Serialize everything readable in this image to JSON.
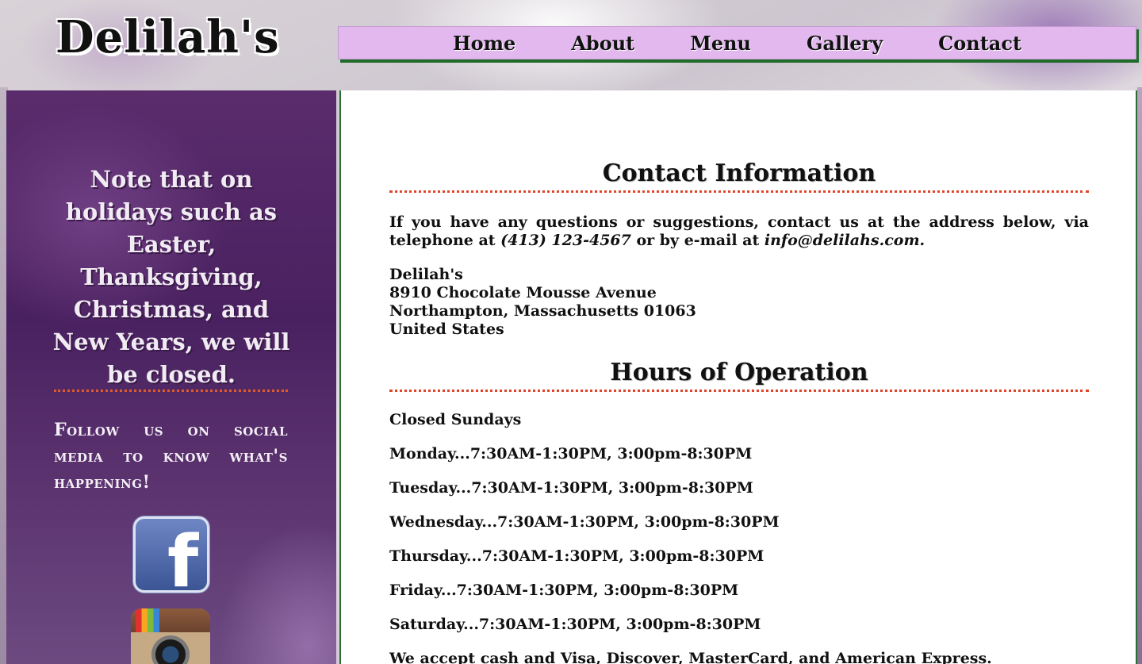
{
  "logo": {
    "text": "Delilah's"
  },
  "nav": {
    "items": [
      {
        "label": "Home"
      },
      {
        "label": "About"
      },
      {
        "label": "Menu"
      },
      {
        "label": "Gallery"
      },
      {
        "label": "Contact"
      }
    ]
  },
  "sidebar": {
    "note": "Note that on holidays such as Easter, Thanksgiving, Christmas, and New Years, we will be closed.",
    "follow": "Follow us on social media to know what's happening!",
    "social": [
      {
        "icon": "facebook-icon",
        "glyph": "f"
      },
      {
        "icon": "instagram-icon"
      }
    ]
  },
  "contact": {
    "heading": "Contact Information",
    "intro_before": "If you have any questions or suggestions, contact us at the address below, via telephone at ",
    "phone": "(413) 123-4567",
    "intro_middle": " or by e-mail at ",
    "email": "info@delilahs.com.",
    "address": {
      "name": "Delilah's",
      "street": "8910 Chocolate Mousse Avenue",
      "city": "Northampton, Massachusetts 01063",
      "country": "United States"
    }
  },
  "hours": {
    "heading": "Hours of Operation",
    "lines": [
      "Closed Sundays",
      "Monday...7:30AM-1:30PM, 3:00pm-8:30PM",
      "Tuesday...7:30AM-1:30PM, 3:00pm-8:30PM",
      "Wednesday...7:30AM-1:30PM, 3:00pm-8:30PM",
      "Thursday...7:30AM-1:30PM, 3:00pm-8:30PM",
      "Friday...7:30AM-1:30PM, 3:00pm-8:30PM",
      "Saturday...7:30AM-1:30PM, 3:00pm-8:30PM",
      "We accept cash and Visa, Discover, MasterCard, and American Express."
    ]
  },
  "colors": {
    "nav_bg": "#e2b8ee",
    "nav_shadow": "#1f6b2a",
    "sidebar_bg": "#4a2160",
    "rule": "#e0452a",
    "content_border": "#2b6d32"
  }
}
